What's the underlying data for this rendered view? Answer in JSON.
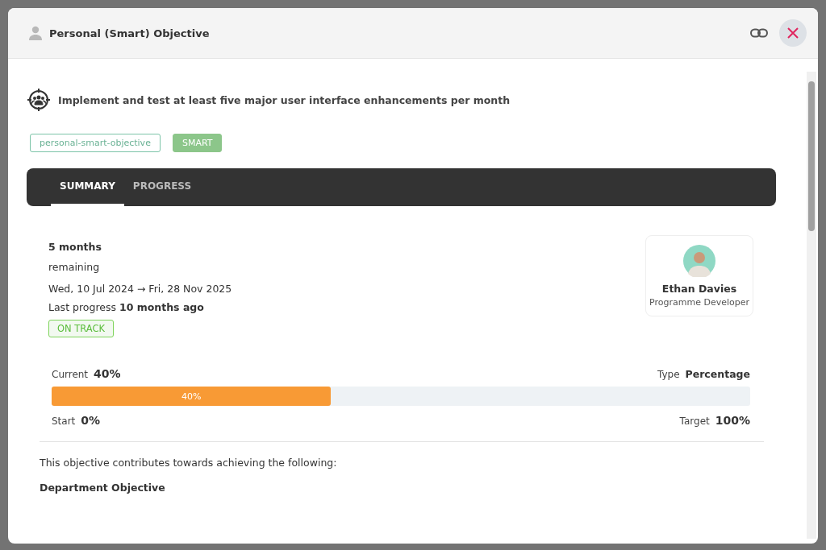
{
  "dialog": {
    "title": "Personal (Smart) Objective"
  },
  "objective": {
    "title": "Implement and test at least five major user interface enhancements per month",
    "tags": [
      {
        "label": "personal-smart-objective",
        "kind": "outline"
      },
      {
        "label": "SMART",
        "kind": "filled"
      }
    ]
  },
  "tabs": [
    {
      "label": "SUMMARY",
      "selected": true
    },
    {
      "label": "PROGRESS",
      "selected": false
    }
  ],
  "summary": {
    "duration": "5 months",
    "remaining": "remaining",
    "dates": "Wed, 10 Jul 2024 → Fri, 28 Nov 2025",
    "last_progress": "Last progress **10 months ago**",
    "status": "ON TRACK"
  },
  "owner": {
    "name": "Ethan Davies",
    "role": "Programme Developer"
  },
  "progress": {
    "current_label": "Current",
    "current": "40%",
    "type_label": "Type",
    "type": "Percentage",
    "level": 0.4,
    "bar_text": "40%",
    "start_label": "Start",
    "start": "0%",
    "target_label": "Target",
    "target": "100%"
  },
  "contributes": {
    "text": "This objective contributes towards achieving the following:",
    "heading": "Department Objective"
  }
}
